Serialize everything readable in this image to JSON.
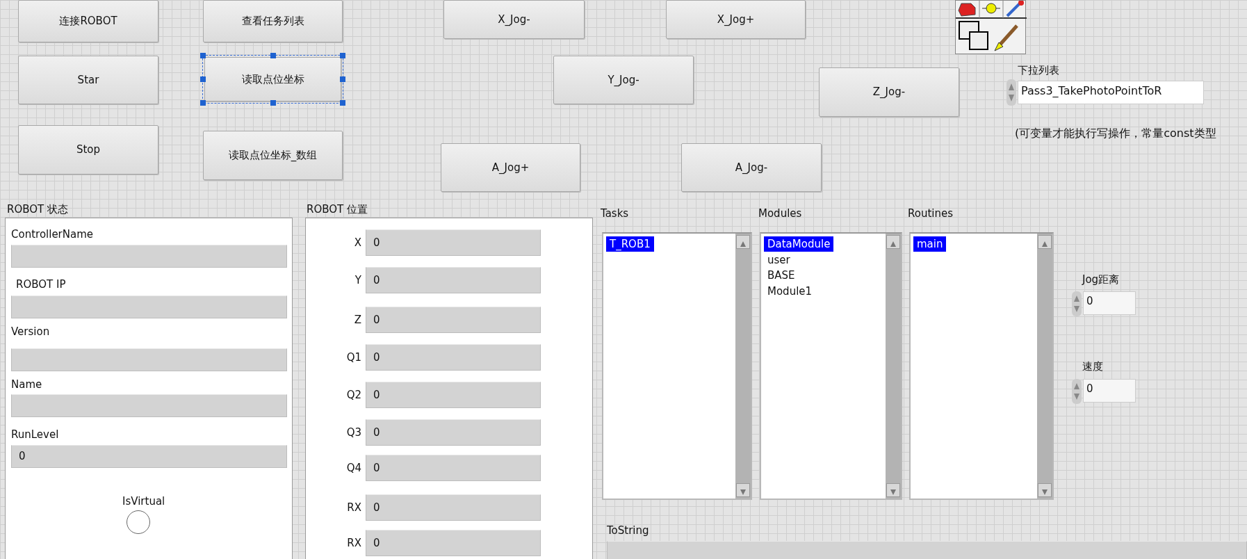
{
  "buttons": [
    {
      "label": "连接ROBOT",
      "selected": false
    },
    {
      "label": "查看任务列表",
      "selected": false
    },
    {
      "label": "X_Jog-",
      "selected": false
    },
    {
      "label": "X_Jog+",
      "selected": false
    },
    {
      "label": "Star",
      "selected": false
    },
    {
      "label": "读取点位坐标",
      "selected": true
    },
    {
      "label": "Y_Jog-",
      "selected": false
    },
    {
      "label": "Z_Jog-",
      "selected": false
    },
    {
      "label": "Stop",
      "selected": false
    },
    {
      "label": "读取点位坐标_数组",
      "selected": false
    },
    {
      "label": "A_Jog+",
      "selected": false
    },
    {
      "label": "A_Jog-",
      "selected": false
    }
  ],
  "ring": {
    "label": "下拉列表",
    "value": "Pass3_TakePhotoPointToR"
  },
  "note": "(可变量才能执行写操作，常量const类型",
  "robot_status": {
    "title": "ROBOT 状态",
    "fields": [
      {
        "label": "ControllerName"
      },
      {
        "label": "ROBOT IP"
      },
      {
        "label": "Version"
      },
      {
        "label": "Name"
      },
      {
        "label": "RunLevel",
        "value": "0"
      }
    ],
    "led": {
      "label": "IsVirtual",
      "on": false
    }
  },
  "robot_position": {
    "title": "ROBOT 位置",
    "fields": [
      {
        "label": "X",
        "value": "0"
      },
      {
        "label": "Y",
        "value": "0"
      },
      {
        "label": "Z",
        "value": "0"
      },
      {
        "label": "Q1",
        "value": "0"
      },
      {
        "label": "Q2",
        "value": "0"
      },
      {
        "label": "Q3",
        "value": "0"
      },
      {
        "label": "Q4",
        "value": "0"
      },
      {
        "label": "RX",
        "value": "0"
      },
      {
        "label": "RX",
        "value": "0"
      }
    ]
  },
  "listboxes": [
    {
      "label": "Tasks",
      "items": [
        {
          "text": "T_ROB1",
          "selected": true
        }
      ]
    },
    {
      "label": "Modules",
      "items": [
        {
          "text": "DataModule",
          "selected": true
        },
        {
          "text": "user",
          "selected": false
        },
        {
          "text": "BASE",
          "selected": false
        },
        {
          "text": "Module1",
          "selected": false
        }
      ]
    },
    {
      "label": "Routines",
      "items": [
        {
          "text": "main",
          "selected": true
        }
      ]
    }
  ],
  "numerics": [
    {
      "label": "Jog距离",
      "value": "0"
    },
    {
      "label": "速度",
      "value": "0"
    }
  ],
  "tostring": {
    "label": "ToString"
  }
}
